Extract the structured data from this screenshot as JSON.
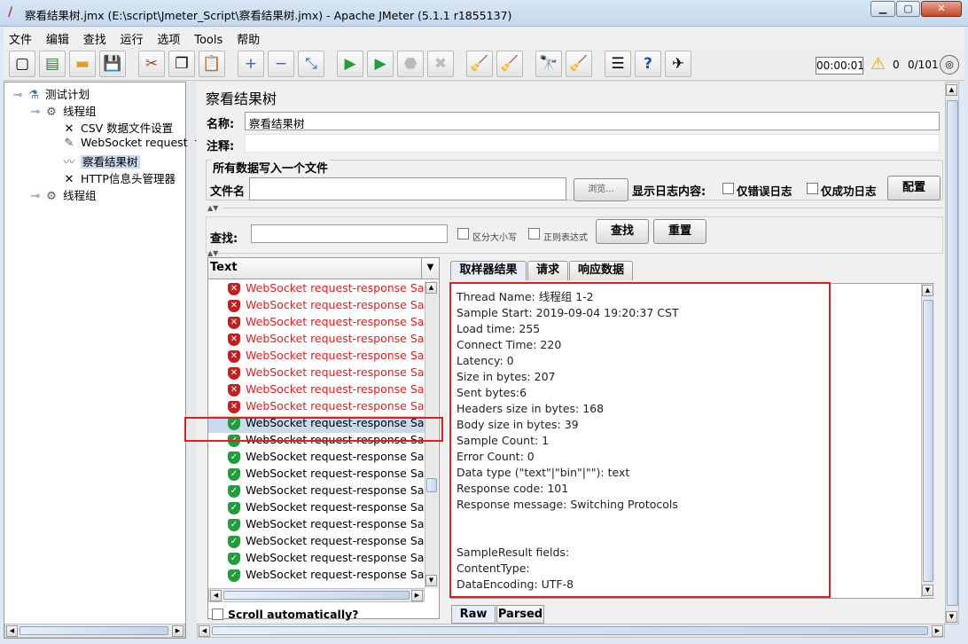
{
  "window": {
    "title": "察看结果树.jmx (E:\\script\\Jmeter_Script\\察看结果树.jmx) - Apache JMeter (5.1.1 r1855137)"
  },
  "menu": [
    "文件",
    "编辑",
    "查找",
    "运行",
    "选项",
    "Tools",
    "帮助"
  ],
  "toolbar": {
    "timer": "00:00:01",
    "error_count": "0",
    "thread_count": "0/101"
  },
  "tree": {
    "items": [
      {
        "label": "测试计划",
        "icon": "flask-icon"
      },
      {
        "label": "线程组",
        "icon": "gear-icon"
      },
      {
        "label": "CSV 数据文件设置",
        "icon": "wrench-icon"
      },
      {
        "label": "WebSocket request-r",
        "icon": "pen-icon"
      },
      {
        "label": "察看结果树",
        "icon": "graph-icon"
      },
      {
        "label": "HTTP信息头管理器",
        "icon": "wrench-icon"
      },
      {
        "label": "线程组",
        "icon": "gear-icon"
      }
    ]
  },
  "panel": {
    "title": "察看结果树",
    "name_label": "名称:",
    "name_value": "察看结果树",
    "comment_label": "注释:",
    "comment_value": "",
    "file_group_title": "所有数据写入一个文件",
    "filename_label": "文件名",
    "filename_value": "",
    "browse_button": "浏览...",
    "log_label": "显示日志内容:",
    "errors_only": "仅错误日志",
    "success_only": "仅成功日志",
    "configure_button": "配置"
  },
  "search": {
    "label": "查找:",
    "value": "",
    "case_sensitive": "区分大小写",
    "regex": "正则表达式",
    "find_button": "查找",
    "reset_button": "重置"
  },
  "results": {
    "renderer": "Text",
    "scroll_auto": "Scroll automatically?",
    "samples": [
      {
        "label": "WebSocket request-response Samp",
        "status": "error"
      },
      {
        "label": "WebSocket request-response Samp",
        "status": "error"
      },
      {
        "label": "WebSocket request-response Samp",
        "status": "error"
      },
      {
        "label": "WebSocket request-response Samp",
        "status": "error"
      },
      {
        "label": "WebSocket request-response Samp",
        "status": "error"
      },
      {
        "label": "WebSocket request-response Samp",
        "status": "error"
      },
      {
        "label": "WebSocket request-response Samp",
        "status": "error"
      },
      {
        "label": "WebSocket request-response Samp",
        "status": "error"
      },
      {
        "label": "WebSocket request-response Samp",
        "status": "ok"
      },
      {
        "label": "WebSocket request-response Samp",
        "status": "ok"
      },
      {
        "label": "WebSocket request-response Samp",
        "status": "ok"
      },
      {
        "label": "WebSocket request-response Samp",
        "status": "ok"
      },
      {
        "label": "WebSocket request-response Samp",
        "status": "ok"
      },
      {
        "label": "WebSocket request-response Samp",
        "status": "ok"
      },
      {
        "label": "WebSocket request-response Samp",
        "status": "ok"
      },
      {
        "label": "WebSocket request-response Samp",
        "status": "ok"
      },
      {
        "label": "WebSocket request-response Samp",
        "status": "ok"
      },
      {
        "label": "WebSocket request-response Samp",
        "status": "ok"
      }
    ],
    "tabs": [
      "取样器结果",
      "请求",
      "响应数据"
    ],
    "bottom_tabs": [
      "Raw",
      "Parsed"
    ],
    "detail_lines": [
      "Thread Name: 线程组 1-2",
      "Sample Start: 2019-09-04 19:20:37 CST",
      "Load time: 255",
      "Connect Time: 220",
      "Latency: 0",
      "Size in bytes: 207",
      "Sent bytes:6",
      "Headers size in bytes: 168",
      "Body size in bytes: 39",
      "Sample Count: 1",
      "Error Count: 0",
      "Data type (\"text\"|\"bin\"|\"\"): text",
      "Response code: 101",
      "Response message: Switching Protocols",
      "",
      "",
      "SampleResult fields:",
      "ContentType: ",
      "DataEncoding: UTF-8"
    ]
  }
}
